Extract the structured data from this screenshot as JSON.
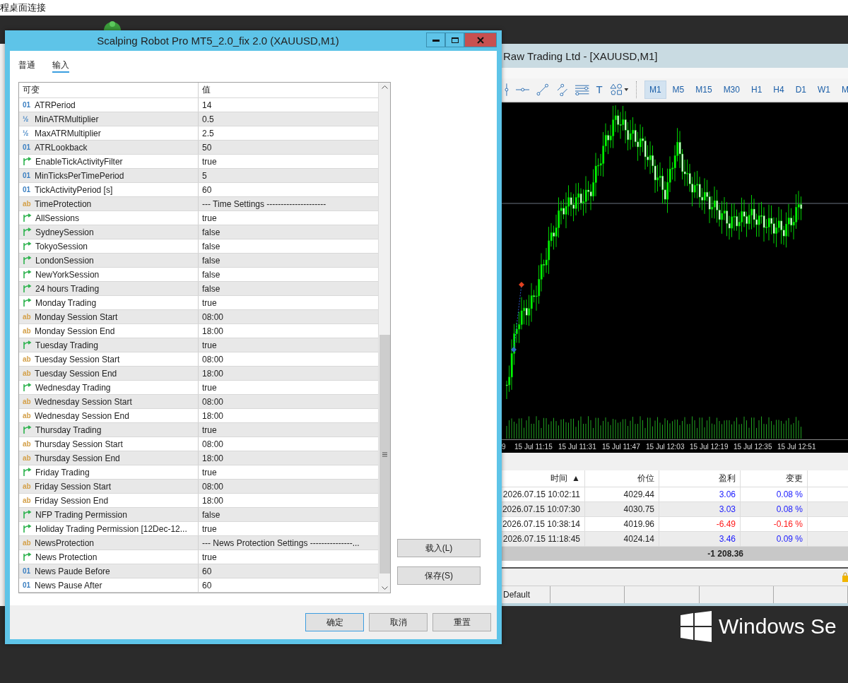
{
  "top_bar": {
    "title": "程桌面连接"
  },
  "dialog": {
    "title": "Scalping Robot Pro MT5_2.0_fix 2.0 (XAUUSD,M1)",
    "tabs": [
      {
        "label": "普通",
        "selected": false
      },
      {
        "label": "输入",
        "selected": true
      }
    ],
    "grid": {
      "columns": [
        "可变",
        "值"
      ],
      "rows": [
        {
          "kind": "number",
          "icon": "01",
          "name": "ATRPeriod",
          "value": "14"
        },
        {
          "kind": "number",
          "icon": "½",
          "name": "MinATRMultiplier",
          "value": "0.5"
        },
        {
          "kind": "number",
          "icon": "½",
          "name": "MaxATRMultiplier",
          "value": "2.5"
        },
        {
          "kind": "number",
          "icon": "01",
          "name": "ATRLookback",
          "value": "50"
        },
        {
          "kind": "bool",
          "name": "EnableTickActivityFilter",
          "value": "true"
        },
        {
          "kind": "number",
          "icon": "01",
          "name": "MinTicksPerTimePeriod",
          "value": "5"
        },
        {
          "kind": "number",
          "icon": "01",
          "name": "TickActivityPeriod [s]",
          "value": "60"
        },
        {
          "kind": "text",
          "icon": "ab",
          "name": "TimeProtection",
          "value": "--- Time Settings ---------------------"
        },
        {
          "kind": "bool",
          "name": "AllSessions",
          "value": "true"
        },
        {
          "kind": "bool",
          "name": "SydneySession",
          "value": "false"
        },
        {
          "kind": "bool",
          "name": "TokyoSession",
          "value": "false"
        },
        {
          "kind": "bool",
          "name": "LondonSession",
          "value": "false"
        },
        {
          "kind": "bool",
          "name": "NewYorkSession",
          "value": "false"
        },
        {
          "kind": "bool",
          "name": "24 hours Trading",
          "value": "false"
        },
        {
          "kind": "bool",
          "name": "Monday Trading",
          "value": "true"
        },
        {
          "kind": "text",
          "icon": "ab",
          "name": "Monday Session Start",
          "value": "08:00"
        },
        {
          "kind": "text",
          "icon": "ab",
          "name": "Monday Session End",
          "value": "18:00"
        },
        {
          "kind": "bool",
          "name": "Tuesday Trading",
          "value": "true"
        },
        {
          "kind": "text",
          "icon": "ab",
          "name": "Tuesday Session Start",
          "value": "08:00"
        },
        {
          "kind": "text",
          "icon": "ab",
          "name": "Tuesday Session End",
          "value": "18:00"
        },
        {
          "kind": "bool",
          "name": "Wednesday Trading",
          "value": "true"
        },
        {
          "kind": "text",
          "icon": "ab",
          "name": "Wednesday Session Start",
          "value": "08:00"
        },
        {
          "kind": "text",
          "icon": "ab",
          "name": "Wednesday Session End",
          "value": "18:00"
        },
        {
          "kind": "bool",
          "name": "Thursday Trading",
          "value": "true"
        },
        {
          "kind": "text",
          "icon": "ab",
          "name": "Thursday Session Start",
          "value": "08:00"
        },
        {
          "kind": "text",
          "icon": "ab",
          "name": "Thursday Session End",
          "value": "18:00"
        },
        {
          "kind": "bool",
          "name": "Friday Trading",
          "value": "true"
        },
        {
          "kind": "text",
          "icon": "ab",
          "name": "Friday Session Start",
          "value": "08:00"
        },
        {
          "kind": "text",
          "icon": "ab",
          "name": "Friday Session End",
          "value": "18:00"
        },
        {
          "kind": "bool",
          "name": "NFP Trading Permission",
          "value": "false"
        },
        {
          "kind": "bool",
          "name": "Holiday Trading Permission [12Dec-12...",
          "value": "true"
        },
        {
          "kind": "text",
          "icon": "ab",
          "name": "NewsProtection",
          "value": "--- News Protection Settings ---------------..."
        },
        {
          "kind": "bool",
          "name": "News Protection",
          "value": "true"
        },
        {
          "kind": "number",
          "icon": "01",
          "name": "News Paude Before",
          "value": "60"
        },
        {
          "kind": "number",
          "icon": "01",
          "name": "News Pause After",
          "value": "60"
        }
      ]
    },
    "side_buttons": [
      "载入(L)",
      "保存(S)"
    ],
    "buttons": [
      {
        "label": "确定",
        "default": true
      },
      {
        "label": "取消",
        "default": false
      },
      {
        "label": "重置",
        "default": false
      }
    ]
  },
  "terminal": {
    "title": "Raw Trading Ltd - [XAUUSD,M1]",
    "text_tool": "T",
    "timeframes": [
      {
        "label": "M1",
        "selected": true
      },
      {
        "label": "M5",
        "selected": false
      },
      {
        "label": "M15",
        "selected": false
      },
      {
        "label": "M30",
        "selected": false
      },
      {
        "label": "H1",
        "selected": false
      },
      {
        "label": "H4",
        "selected": false
      },
      {
        "label": "D1",
        "selected": false
      },
      {
        "label": "W1",
        "selected": false
      },
      {
        "label": "M",
        "selected": false
      }
    ],
    "time_axis": [
      "9",
      "15 Jul 11:15",
      "15 Jul 11:31",
      "15 Jul 11:47",
      "15 Jul 12:03",
      "15 Jul 12:19",
      "15 Jul 12:35",
      "15 Jul 12:51"
    ],
    "trades": {
      "columns": [
        {
          "label": "时间",
          "sort": "▲"
        },
        {
          "label": "价位"
        },
        {
          "label": "盈利"
        },
        {
          "label": "变更"
        }
      ],
      "rows": [
        {
          "time": "2026.07.15 10:02:11",
          "price": "4029.44",
          "profit": "3.06",
          "change": "0.08 %",
          "loss": false
        },
        {
          "time": "2026.07.15 10:07:30",
          "price": "4030.75",
          "profit": "3.03",
          "change": "0.08 %",
          "loss": false
        },
        {
          "time": "2026.07.15 10:38:14",
          "price": "4019.96",
          "profit": "-6.49",
          "change": "-0.16 %",
          "loss": true
        },
        {
          "time": "2026.07.15 11:18:45",
          "price": "4024.14",
          "profit": "3.46",
          "change": "0.09 %",
          "loss": false
        }
      ],
      "total": "-1 208.36"
    },
    "status_bar": [
      "Default"
    ]
  },
  "desktop": {
    "brand": "Windows Se"
  }
}
